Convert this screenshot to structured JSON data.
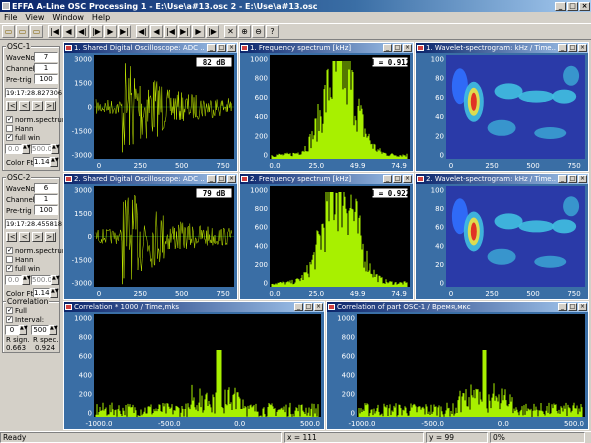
{
  "window": {
    "title": "A-Line OSC Processing   1 - E:\\Use\\a#13.osc   2 - E:\\Use\\a#13.osc",
    "logo": "EFFA",
    "min": "_",
    "max": "□",
    "close": "×"
  },
  "menu": [
    "File",
    "View",
    "Window",
    "Help"
  ],
  "toolbar_icons": [
    "open-icon",
    "save-icon",
    "save-all-icon",
    "first-icon",
    "prev-icon",
    "step-back-icon",
    "step-forward-icon",
    "next-icon",
    "last-icon",
    "first2-icon",
    "prev2-icon",
    "step-back2-icon",
    "step-forward2-icon",
    "next2-icon",
    "last2-icon",
    "cross-icon",
    "zoom-in-icon",
    "zoom-out-icon",
    "help-icon"
  ],
  "toolbar_glyphs": [
    "▭",
    "▭",
    "▭",
    "|◀",
    "◀",
    "◀|",
    "|▶",
    "▶",
    "▶|",
    "◀|",
    "◀",
    "|◀",
    "▶|",
    "▶",
    "|▶",
    "✕",
    "⊕",
    "⊖",
    "?"
  ],
  "osc1": {
    "title": "OSC-1",
    "waveno_label": "WaveNo",
    "waveno": "7",
    "channel_label": "Channel",
    "channel": "1",
    "pretrig_label": "Pre-trig",
    "pretrig": "100",
    "time": "19:17:28.827306",
    "nav": [
      "|<",
      "<",
      ">",
      ">|"
    ],
    "norm_spectrum": "norm.spectrum",
    "hann": "Hann",
    "full_win": "full win",
    "norm_checked": true,
    "hann_checked": false,
    "fullwin_checked": true,
    "from": "0.0",
    "to": "500.0",
    "color_label": "Color Ft",
    "color_value": "1.14"
  },
  "osc2": {
    "title": "OSC-2",
    "waveno_label": "WaveNo",
    "waveno": "6",
    "channel_label": "Channel",
    "channel": "1",
    "pretrig_label": "Pre-trig",
    "pretrig": "100",
    "time": "19:17:28.455818",
    "nav": [
      "|<",
      "<",
      ">",
      ">|"
    ],
    "norm_spectrum": "norm.spectrum",
    "hann": "Hann",
    "full_win": "full win",
    "norm_checked": true,
    "hann_checked": false,
    "fullwin_checked": true,
    "from": "0.0",
    "to": "500.0",
    "color_label": "Color Ft",
    "color_value": "1.14"
  },
  "correlation": {
    "title": "Correlation",
    "full": "Full",
    "interval": "Interval:",
    "full_checked": true,
    "interval_checked": true,
    "from": "0",
    "to": "500",
    "r_sign_label": "R sign.",
    "r_sign": "0.663",
    "r_spec_label": "R spec.",
    "r_spec": "0.924"
  },
  "panels": {
    "osc1_wave": {
      "title": "1. Shared Digital Oscilloscope: ADC ..",
      "badge": "82 dB",
      "y_ticks": [
        "3000",
        "1500",
        "0",
        "-1500",
        "-3000"
      ],
      "x_ticks": [
        "0",
        "250",
        "500",
        "750"
      ]
    },
    "osc1_spec": {
      "title": "1. Frequency spectrum [kHz]",
      "badge": "H = 0.912",
      "y_ticks": [
        "1000",
        "800",
        "600",
        "400",
        "200",
        "0"
      ],
      "x_ticks": [
        "0.0",
        "25.0",
        "49.9",
        "74.9"
      ]
    },
    "osc1_wavelet": {
      "title": "1. Wavelet-spectrogram: kHz / Time..",
      "y_ticks": [
        "100",
        "80",
        "60",
        "40",
        "20",
        "0"
      ],
      "x_ticks": [
        "0",
        "250",
        "500",
        "750"
      ]
    },
    "osc2_wave": {
      "title": "2. Shared Digital Oscilloscope: ADC ..",
      "badge": "79 dB",
      "y_ticks": [
        "3000",
        "1500",
        "0",
        "-1500",
        "-3000"
      ],
      "x_ticks": [
        "0",
        "250",
        "500",
        "750"
      ]
    },
    "osc2_spec": {
      "title": "2. Frequency spectrum [kHz]",
      "badge": "H = 0.922",
      "y_ticks": [
        "1000",
        "800",
        "600",
        "400",
        "200",
        "0"
      ],
      "x_ticks": [
        "0.0",
        "25.0",
        "49.9",
        "74.9"
      ]
    },
    "osc2_wavelet": {
      "title": "2. Wavelet-spectrogram: kHz / Time..",
      "y_ticks": [
        "100",
        "80",
        "60",
        "40",
        "20",
        "0"
      ],
      "x_ticks": [
        "0",
        "250",
        "500",
        "750"
      ]
    },
    "corr_all": {
      "title": "Correlation * 1000 / Time,mks",
      "y_ticks": [
        "1000",
        "800",
        "600",
        "400",
        "200",
        "0"
      ],
      "x_ticks": [
        "-1000.0",
        "-500.0",
        "0.0",
        "500.0"
      ]
    },
    "corr_part": {
      "title": "Correlation of part OSC-1 / Время,мкс",
      "y_ticks": [
        "1000",
        "800",
        "600",
        "400",
        "200",
        "0"
      ],
      "x_ticks": [
        "-1000.0",
        "-500.0",
        "0.0",
        "500.0"
      ]
    }
  },
  "status": {
    "state": "Ready",
    "x": "x = 111",
    "y": "y = 99",
    "pct": "0%"
  }
}
